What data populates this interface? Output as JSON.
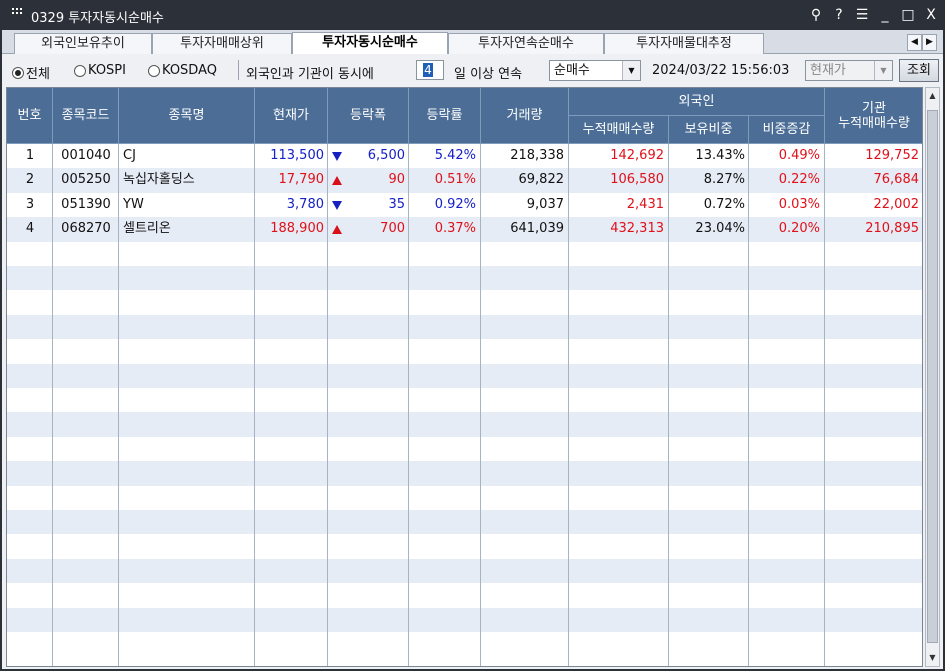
{
  "window": {
    "title": "0329 투자자동시순매수",
    "buttons": {
      "pin": "⚲",
      "help": "?",
      "menu": "☰",
      "minimize": "_",
      "maximize": "□",
      "close": "X"
    }
  },
  "tabs": [
    {
      "label": "외국인보유추이",
      "active": false
    },
    {
      "label": "투자자매매상위",
      "active": false
    },
    {
      "label": "투자자동시순매수",
      "active": true
    },
    {
      "label": "투자자연속순매수",
      "active": false
    },
    {
      "label": "투자자매물대추정",
      "active": false
    }
  ],
  "tab_nav": {
    "prev": "◀",
    "next": "▶"
  },
  "filters": {
    "market_radios": [
      {
        "label": "전체",
        "selected": true
      },
      {
        "label": "KOSPI",
        "selected": false
      },
      {
        "label": "KOSDAQ",
        "selected": false
      }
    ],
    "condition_prefix": "외국인과 기관이 동시에",
    "days_value": "4",
    "condition_suffix": "일 이상 연속",
    "type_select": "순매수",
    "datetime": "2024/03/22  15:56:03",
    "price_select": "현재가",
    "query_button": "조회"
  },
  "table": {
    "headers": {
      "no": "번호",
      "code": "종목코드",
      "name": "종목명",
      "price": "현재가",
      "change": "등락폭",
      "rate": "등락률",
      "volume": "거래량",
      "foreign_group": "외국인",
      "foreign_cum": "누적매매수량",
      "foreign_hold": "보유비중",
      "foreign_delta": "비중증감",
      "inst_group": "기관",
      "inst_cum": "누적매매수량"
    },
    "rows": [
      {
        "no": "1",
        "code": "001040",
        "name": "CJ",
        "price": "113,500",
        "dir": "down",
        "change": "6,500",
        "rate": "5.42%",
        "volume": "218,338",
        "foreign_cum": "142,692",
        "foreign_hold": "13.43%",
        "foreign_delta": "0.49%",
        "inst_cum": "129,752"
      },
      {
        "no": "2",
        "code": "005250",
        "name": "녹십자홀딩스",
        "price": "17,790",
        "dir": "up",
        "change": "90",
        "rate": "0.51%",
        "volume": "69,822",
        "foreign_cum": "106,580",
        "foreign_hold": "8.27%",
        "foreign_delta": "0.22%",
        "inst_cum": "76,684"
      },
      {
        "no": "3",
        "code": "051390",
        "name": "YW",
        "price": "3,780",
        "dir": "down",
        "change": "35",
        "rate": "0.92%",
        "volume": "9,037",
        "foreign_cum": "2,431",
        "foreign_hold": "0.72%",
        "foreign_delta": "0.03%",
        "inst_cum": "22,002"
      },
      {
        "no": "4",
        "code": "068270",
        "name": "셀트리온",
        "price": "188,900",
        "dir": "up",
        "change": "700",
        "rate": "0.37%",
        "volume": "641,039",
        "foreign_cum": "432,313",
        "foreign_hold": "23.04%",
        "foreign_delta": "0.20%",
        "inst_cum": "210,895"
      }
    ]
  },
  "scrollbar": {
    "up": "▲",
    "down": "▼"
  },
  "colors": {
    "up": "#e0101a",
    "down": "#1520c8",
    "header_bg": "#4c6e96",
    "row_alt": "#e6ecf5"
  }
}
